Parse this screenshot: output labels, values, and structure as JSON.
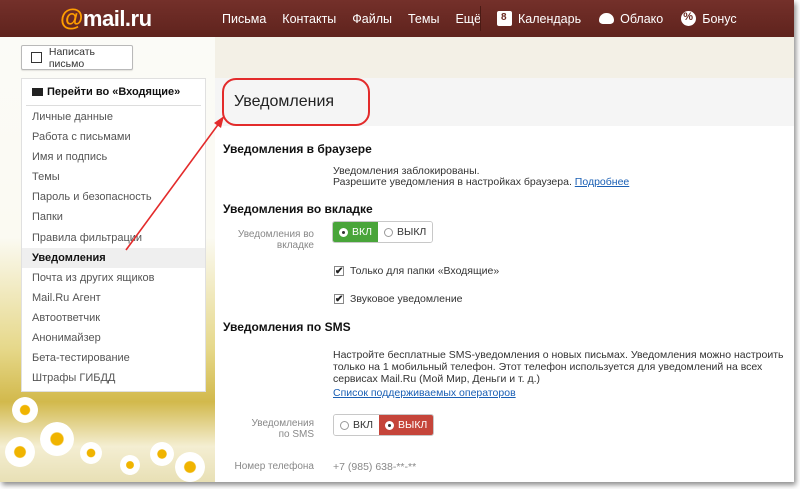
{
  "header": {
    "logo_at": "@",
    "logo_text": "mail.ru",
    "nav": [
      "Письма",
      "Контакты",
      "Файлы",
      "Темы",
      "Ещё"
    ],
    "apps": [
      {
        "icon": "calendar-icon",
        "label": "Календарь"
      },
      {
        "icon": "cloud-icon",
        "label": "Облако"
      },
      {
        "icon": "bonus-icon",
        "label": "Бонус"
      }
    ]
  },
  "compose": {
    "label": "Написать письмо"
  },
  "sidebar": {
    "goto_label": "Перейти во «Входящие»",
    "items": [
      {
        "label": "Личные данные"
      },
      {
        "label": "Работа с письмами"
      },
      {
        "label": "Имя и подпись"
      },
      {
        "label": "Темы"
      },
      {
        "label": "Пароль и безопасность"
      },
      {
        "label": "Папки"
      },
      {
        "label": "Правила фильтрации"
      },
      {
        "label": "Уведомления",
        "active": true
      },
      {
        "label": "Почта из других ящиков"
      },
      {
        "label": "Mail.Ru Агент"
      },
      {
        "label": "Автоответчик"
      },
      {
        "label": "Анонимайзер"
      },
      {
        "label": "Бета-тестирование"
      },
      {
        "label": "Штрафы ГИБДД"
      }
    ]
  },
  "main": {
    "title": "Уведомления",
    "browser": {
      "heading": "Уведомления в браузере",
      "line1": "Уведомления заблокированы.",
      "line2": "Разрешите уведомления в настройках браузера.",
      "more_link": "Подробнее"
    },
    "tab": {
      "heading": "Уведомления во вкладке",
      "label_line1": "Уведомления во",
      "label_line2": "вкладке",
      "on": "ВКЛ",
      "off": "ВЫКЛ",
      "selected": "on",
      "inbox_only": "Только для папки «Входящие»",
      "sound": "Звуковое уведомление"
    },
    "sms": {
      "heading": "Уведомления по SMS",
      "desc_line1": "Настройте бесплатные SMS-уведомления о новых письмах. Уведомления можно настроить",
      "desc_line2": "только на 1 мобильный телефон. Этот телефон используется для уведомлений на всех",
      "desc_line3": "сервисах Mail.Ru (Мой Мир, Деньги и т. д.)",
      "operators_link": "Список поддерживаемых операторов",
      "label_line1": "Уведомления",
      "label_line2": "по SMS",
      "on": "ВКЛ",
      "off": "ВЫКЛ",
      "selected": "off",
      "phone_label": "Номер телефона",
      "phone_value": "+7 (985) 638-**-**"
    }
  },
  "colors": {
    "topbar": "#6b2a22",
    "on_green": "#49a53a",
    "off_red": "#c5453a",
    "annotation_red": "#e32b2b",
    "link": "#1a5fb4"
  }
}
